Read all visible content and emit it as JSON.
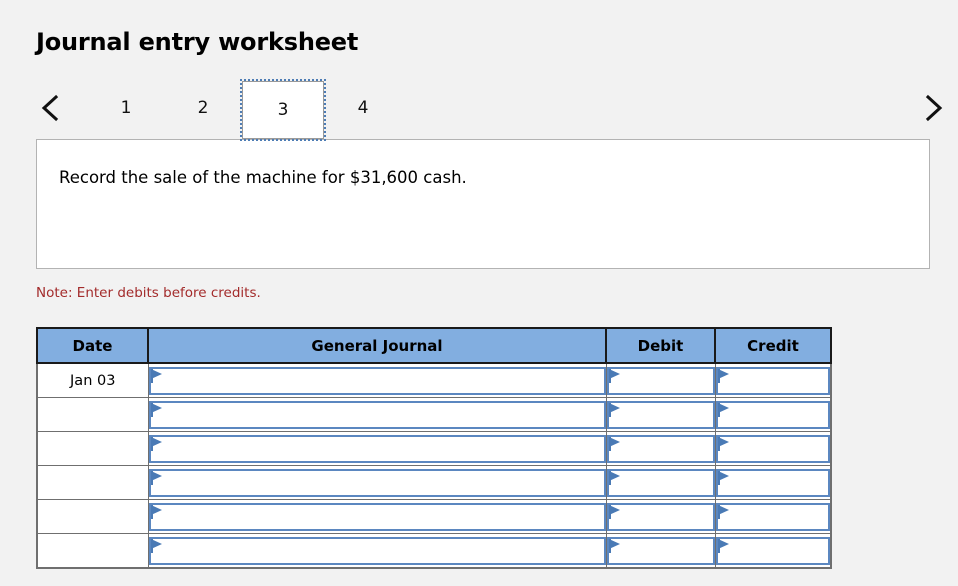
{
  "page": {
    "title": "Journal entry worksheet",
    "background_color": "#f2f2f2"
  },
  "navigation": {
    "prev_icon": "chevron-left-icon",
    "next_icon": "chevron-right-icon",
    "tabs": [
      {
        "label": "1",
        "active": false
      },
      {
        "label": "2",
        "active": false
      },
      {
        "label": "3",
        "active": true
      },
      {
        "label": "4",
        "active": false
      }
    ],
    "active_tab": "3"
  },
  "description": {
    "text": "Record the sale of the machine for $31,600 cash."
  },
  "note": {
    "text": "Note: Enter debits before credits."
  },
  "journal": {
    "header_color": "#82aee0",
    "columns": [
      "Date",
      "General Journal",
      "Debit",
      "Credit"
    ],
    "rows": [
      {
        "date": "Jan 03",
        "general_journal": "",
        "debit": "",
        "credit": ""
      },
      {
        "date": "",
        "general_journal": "",
        "debit": "",
        "credit": ""
      },
      {
        "date": "",
        "general_journal": "",
        "debit": "",
        "credit": ""
      },
      {
        "date": "",
        "general_journal": "",
        "debit": "",
        "credit": ""
      },
      {
        "date": "",
        "general_journal": "",
        "debit": "",
        "credit": ""
      },
      {
        "date": "",
        "general_journal": "",
        "debit": "",
        "credit": ""
      }
    ]
  }
}
